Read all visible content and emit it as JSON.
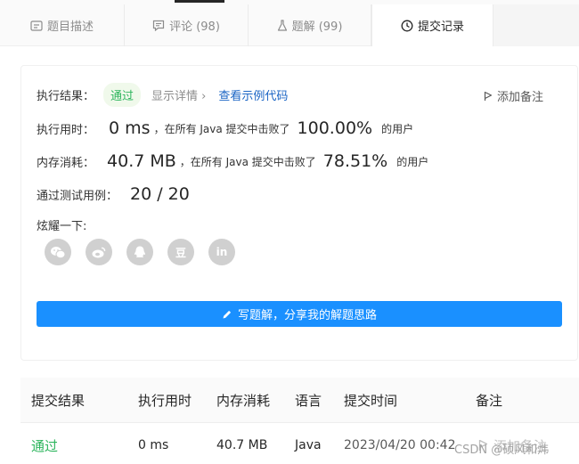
{
  "tabs": [
    {
      "label": "题目描述",
      "icon": "description-icon"
    },
    {
      "label": "评论 (98)",
      "icon": "comment-icon"
    },
    {
      "label": "题解 (99)",
      "icon": "flask-icon"
    },
    {
      "label": "提交记录",
      "icon": "clock-icon"
    }
  ],
  "result": {
    "label": "执行结果：",
    "status": "通过",
    "details_link": "显示详情 ›",
    "example_link": "查看示例代码",
    "add_note": "添加备注"
  },
  "runtime": {
    "label": "执行用时：",
    "value": "0 ms",
    "text": "，在所有 Java 提交中击败了",
    "percent": "100.00%",
    "suffix": "的用户"
  },
  "memory": {
    "label": "内存消耗：",
    "value": "40.7 MB",
    "text": "，在所有 Java 提交中击败了",
    "percent": "78.51%",
    "suffix": "的用户"
  },
  "testcases": {
    "label": "通过测试用例：",
    "value": "20 / 20"
  },
  "share": {
    "label": "炫耀一下:",
    "buttons": [
      "wechat-icon",
      "weibo-icon",
      "qq-icon",
      "douban-icon",
      "linkedin-icon"
    ],
    "douban_text": "豆",
    "linkedin_text": "in"
  },
  "write_solution": "写题解，分享我的解题思路",
  "table": {
    "headers": [
      "提交结果",
      "执行用时",
      "内存消耗",
      "语言",
      "提交时间",
      "备注"
    ],
    "rows": [
      {
        "result": "通过",
        "runtime": "0 ms",
        "memory": "40.7 MB",
        "language": "Java",
        "time": "2023/04/20 00:42",
        "note": "添加备注"
      }
    ]
  },
  "watermark": "CSDN @硕风和炜",
  "colors": {
    "accent": "#1a90ff",
    "pass": "#2db55d",
    "link": "#1a64c4"
  }
}
